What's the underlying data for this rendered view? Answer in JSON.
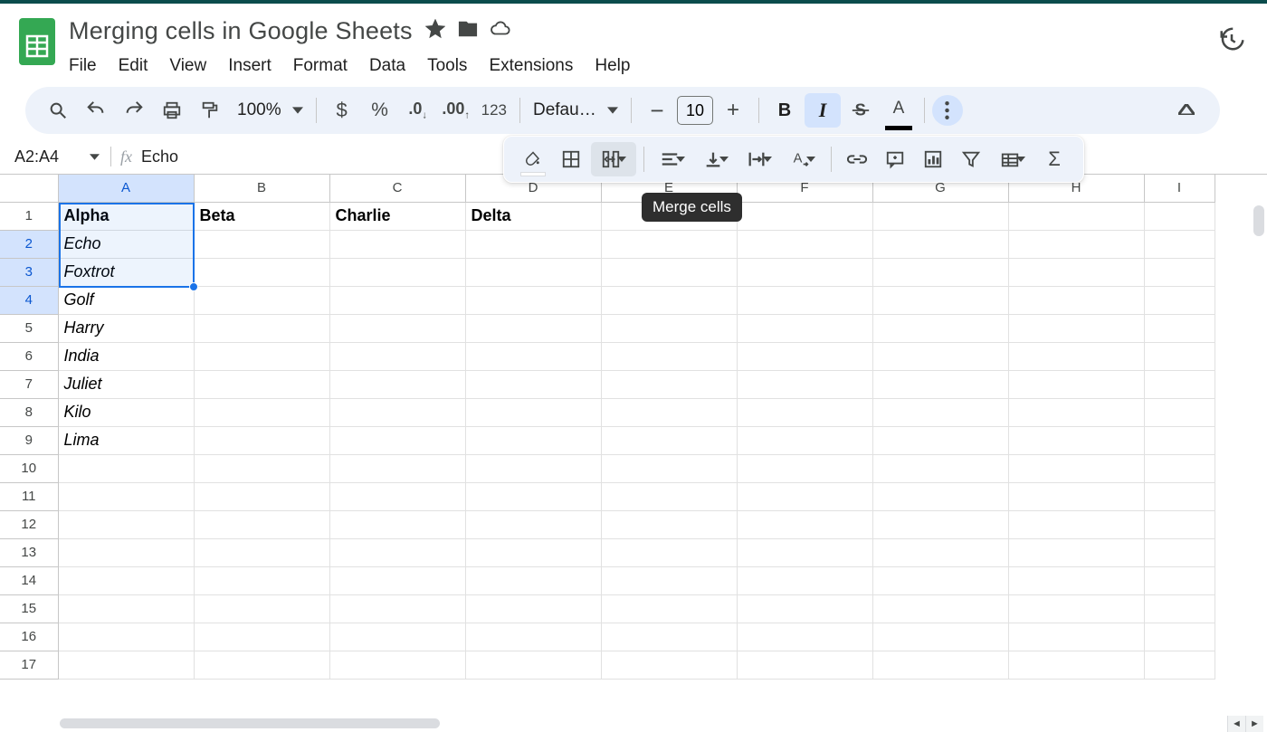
{
  "doc": {
    "title": "Merging cells in Google Sheets"
  },
  "menu": {
    "file": "File",
    "edit": "Edit",
    "view": "View",
    "insert": "Insert",
    "format": "Format",
    "data": "Data",
    "tools": "Tools",
    "extensions": "Extensions",
    "help": "Help"
  },
  "toolbar": {
    "zoom": "100%",
    "fmt123": "123",
    "font": "Defaul...",
    "font_size": "10"
  },
  "tooltip": {
    "merge_cells": "Merge cells"
  },
  "namebox": {
    "range": "A2:A4"
  },
  "formula": {
    "value": "Echo"
  },
  "columns": [
    "A",
    "B",
    "C",
    "D",
    "E",
    "F",
    "G",
    "H",
    "I"
  ],
  "rows": [
    "1",
    "2",
    "3",
    "4",
    "5",
    "6",
    "7",
    "8",
    "9",
    "10",
    "11",
    "12",
    "13",
    "14",
    "15",
    "16",
    "17"
  ],
  "cells": {
    "A1": "Alpha",
    "B1": "Beta",
    "C1": "Charlie",
    "D1": "Delta",
    "A2": "Echo",
    "A3": "Foxtrot",
    "A4": "Golf",
    "A5": "Harry",
    "A6": "India",
    "A7": "Juliet",
    "A8": "Kilo",
    "A9": "Lima"
  }
}
